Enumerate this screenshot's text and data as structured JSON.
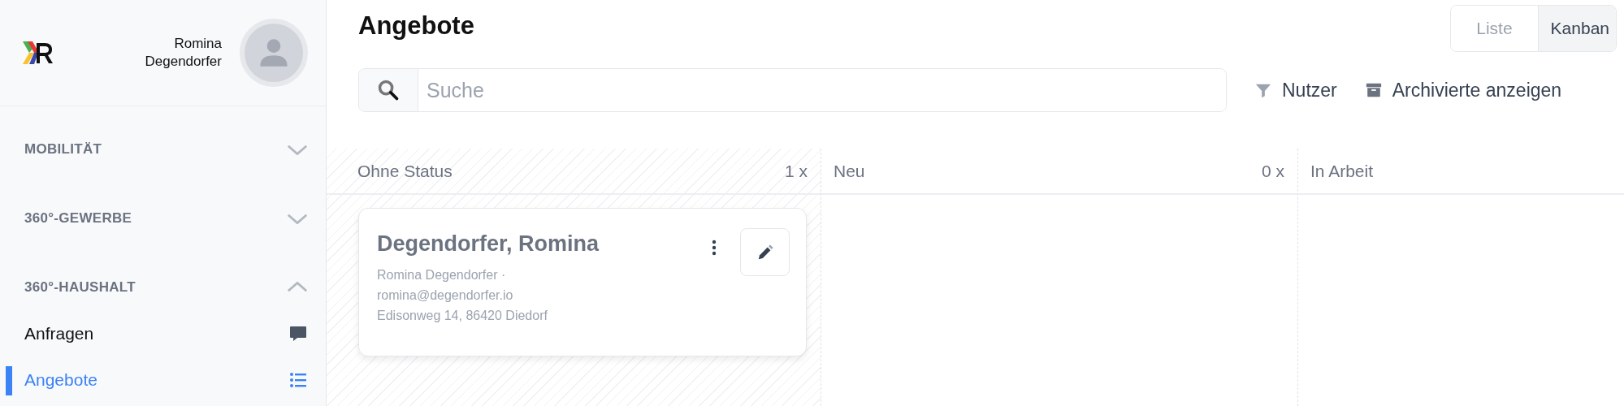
{
  "user": {
    "name": "Romina Degendorfer"
  },
  "sidebar": {
    "sections": [
      {
        "label": "MOBILITÄT",
        "expanded": false
      },
      {
        "label": "360°-GEWERBE",
        "expanded": false
      },
      {
        "label": "360°-HAUSHALT",
        "expanded": true,
        "items": [
          {
            "label": "Anfragen",
            "kind": "chat",
            "selected": false
          },
          {
            "label": "Angebote",
            "kind": "list",
            "selected": true
          }
        ]
      }
    ]
  },
  "page": {
    "title": "Angebote"
  },
  "view_toggle": [
    {
      "label": "Liste",
      "selected": false
    },
    {
      "label": "Kanban",
      "selected": true
    }
  ],
  "search": {
    "placeholder": "Suche"
  },
  "filters": [
    {
      "label": "Nutzer",
      "kind": "filter"
    },
    {
      "label": "Archivierte anzeigen",
      "kind": "archive"
    }
  ],
  "columns": [
    {
      "title": "Ohne Status",
      "count": "1 x",
      "striped": true,
      "cards": [
        {
          "title": "Degendorfer, Romina",
          "lines": [
            "Romina Degendorfer ·",
            "romina@degendorfer.io",
            "Edisonweg 14, 86420 Diedorf"
          ]
        }
      ]
    },
    {
      "title": "Neu",
      "count": "0 x",
      "striped": false
    },
    {
      "title": "In Arbeit",
      "striped": false
    }
  ]
}
